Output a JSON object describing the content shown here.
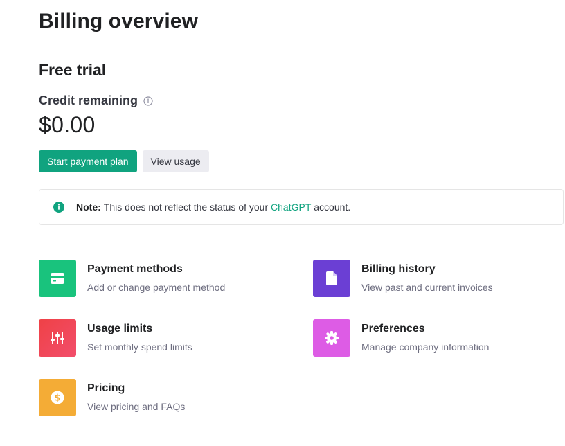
{
  "page": {
    "title": "Billing overview"
  },
  "plan": {
    "name": "Free trial",
    "credit_label": "Credit remaining",
    "credit_amount": "$0.00"
  },
  "buttons": {
    "start_payment_plan": "Start payment plan",
    "view_usage": "View usage"
  },
  "note": {
    "label": "Note:",
    "text_before": "This does not reflect the status of your",
    "link": "ChatGPT",
    "text_after": "account."
  },
  "cards": {
    "payment_methods": {
      "title": "Payment methods",
      "desc": "Add or change payment method",
      "icon": "credit-card-icon",
      "color": "#19c37d"
    },
    "billing_history": {
      "title": "Billing history",
      "desc": "View past and current invoices",
      "icon": "document-icon",
      "color": "#6b3fd4"
    },
    "usage_limits": {
      "title": "Usage limits",
      "desc": "Set monthly spend limits",
      "icon": "sliders-icon",
      "color": "#ef4146"
    },
    "preferences": {
      "title": "Preferences",
      "desc": "Manage company information",
      "icon": "gear-icon",
      "color": "#dd5ce5"
    },
    "pricing": {
      "title": "Pricing",
      "desc": "View pricing and FAQs",
      "icon": "dollar-icon",
      "color": "#f4ac36"
    }
  },
  "colors": {
    "accent": "#10a37f",
    "secondary_button": "#ececf1"
  }
}
